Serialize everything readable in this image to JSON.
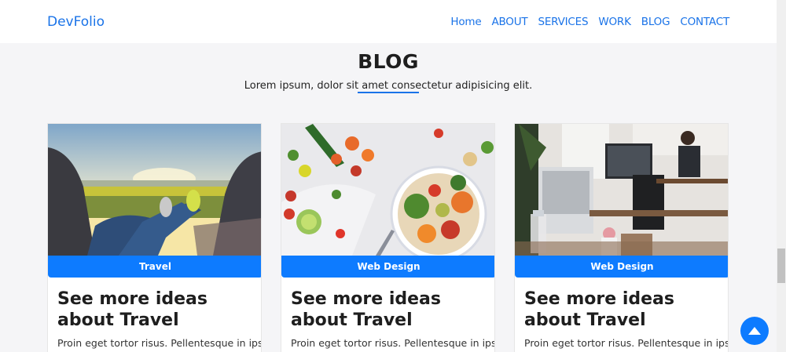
{
  "navbar": {
    "brand": "DevFolio",
    "links": [
      "Home",
      "ABOUT",
      "SERVICES",
      "WORK",
      "BLOG",
      "CONTACT"
    ]
  },
  "section": {
    "title": "BLOG",
    "subtitle": "Lorem ipsum, dolor sit amet consectetur adipisicing elit."
  },
  "cards": [
    {
      "category": "Travel",
      "title": "See more ideas about Travel",
      "text": "Proin eget tortor risus. Pellentesque in ipsum",
      "image": "travel-photo"
    },
    {
      "category": "Web Design",
      "title": "See more ideas about Travel",
      "text": "Proin eget tortor risus. Pellentesque in ipsum",
      "image": "food-photo"
    },
    {
      "category": "Web Design",
      "title": "See more ideas about Travel",
      "text": "Proin eget tortor risus. Pellentesque in ipsum",
      "image": "office-photo"
    }
  ],
  "icons": {
    "back_to_top": "arrow-up-icon"
  },
  "colors": {
    "accent": "#0d7bff",
    "link": "#1a73e8",
    "background": "#f5f5f7"
  }
}
